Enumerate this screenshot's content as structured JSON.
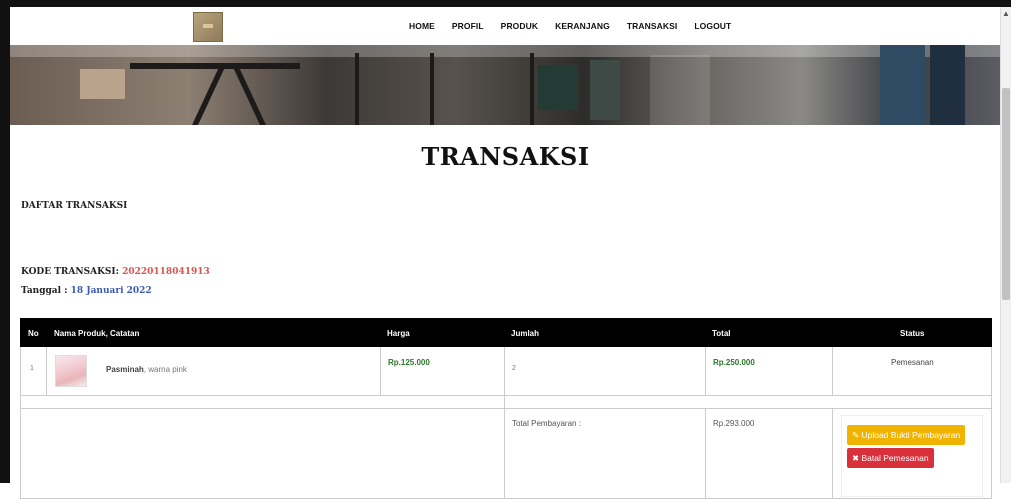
{
  "navbar": {
    "items": [
      "HOME",
      "PROFIL",
      "PRODUK",
      "KERANJANG",
      "TRANSAKSI",
      "LOGOUT"
    ]
  },
  "page": {
    "title": "TRANSAKSI",
    "section_label": "DAFTAR TRANSAKSI",
    "kode_label": "KODE TRANSAKSI:",
    "kode_value": "20220118041913",
    "tanggal_label": "Tanggal :",
    "tanggal_value": "18 Januari 2022"
  },
  "table": {
    "headers": {
      "no": "No",
      "produk": "Nama Produk, Catatan",
      "harga": "Harga",
      "jumlah": "Jumlah",
      "total": "Total",
      "status": "Status"
    },
    "rows": [
      {
        "no": "1",
        "product_name": "Pasminah",
        "note": ", warna pink",
        "harga": "Rp.125.000",
        "jumlah": "2",
        "total": "Rp.250.000",
        "status": "Pemesanan"
      }
    ],
    "summary": {
      "label": "Total Pembayaran :",
      "value": "Rp.293.000"
    }
  },
  "actions": {
    "upload_label": "Upload Bukti Pembayaran",
    "cancel_label": "Batal Pemesanan"
  },
  "colors": {
    "kode": "#d9534f",
    "tanggal": "#3b5bb5",
    "price": "#2a7a2a",
    "upload_button": "#f0b400",
    "cancel_button": "#d9303c"
  }
}
